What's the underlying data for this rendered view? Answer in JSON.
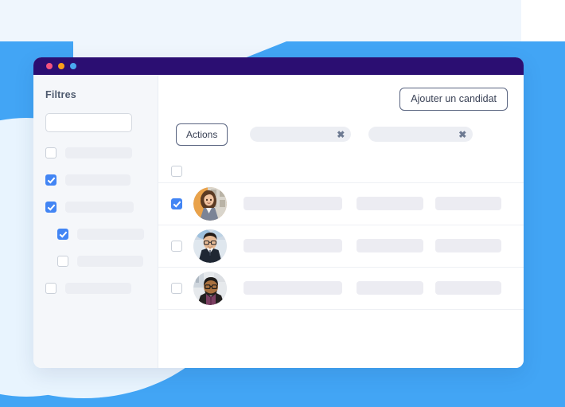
{
  "window": {
    "traffic_lights": [
      "red-dot",
      "yellow-dot",
      "blue-dot"
    ]
  },
  "sidebar": {
    "title": "Filtres",
    "search": {
      "value": "",
      "placeholder": ""
    },
    "items": [
      {
        "checked": false,
        "indent": false,
        "label": ""
      },
      {
        "checked": true,
        "indent": false,
        "label": ""
      },
      {
        "checked": true,
        "indent": false,
        "label": ""
      },
      {
        "checked": true,
        "indent": true,
        "label": ""
      },
      {
        "checked": false,
        "indent": true,
        "label": ""
      },
      {
        "checked": false,
        "indent": false,
        "label": ""
      }
    ]
  },
  "main": {
    "add_candidate_label": "Ajouter un candidat",
    "actions_label": "Actions",
    "filter_chips": [
      {
        "label": "",
        "remove_label": "✖"
      },
      {
        "label": "",
        "remove_label": "✖"
      }
    ],
    "table": {
      "select_all_checked": false,
      "rows": [
        {
          "checked": true,
          "avatar": "woman-brown-hair-orange-bg",
          "cells": [
            "",
            "",
            ""
          ]
        },
        {
          "checked": false,
          "avatar": "man-glasses-dark-suit",
          "cells": [
            "",
            "",
            ""
          ]
        },
        {
          "checked": false,
          "avatar": "man-glasses-beard-purple-shirt",
          "cells": [
            "",
            "",
            ""
          ]
        }
      ]
    }
  },
  "colors": {
    "accent_blue": "#42a5f5",
    "titlebar_purple": "#2b0e72",
    "checkbox_blue": "#4285f4",
    "pale_blue": "#eff6fd",
    "placeholder_gray": "#eceef3"
  }
}
